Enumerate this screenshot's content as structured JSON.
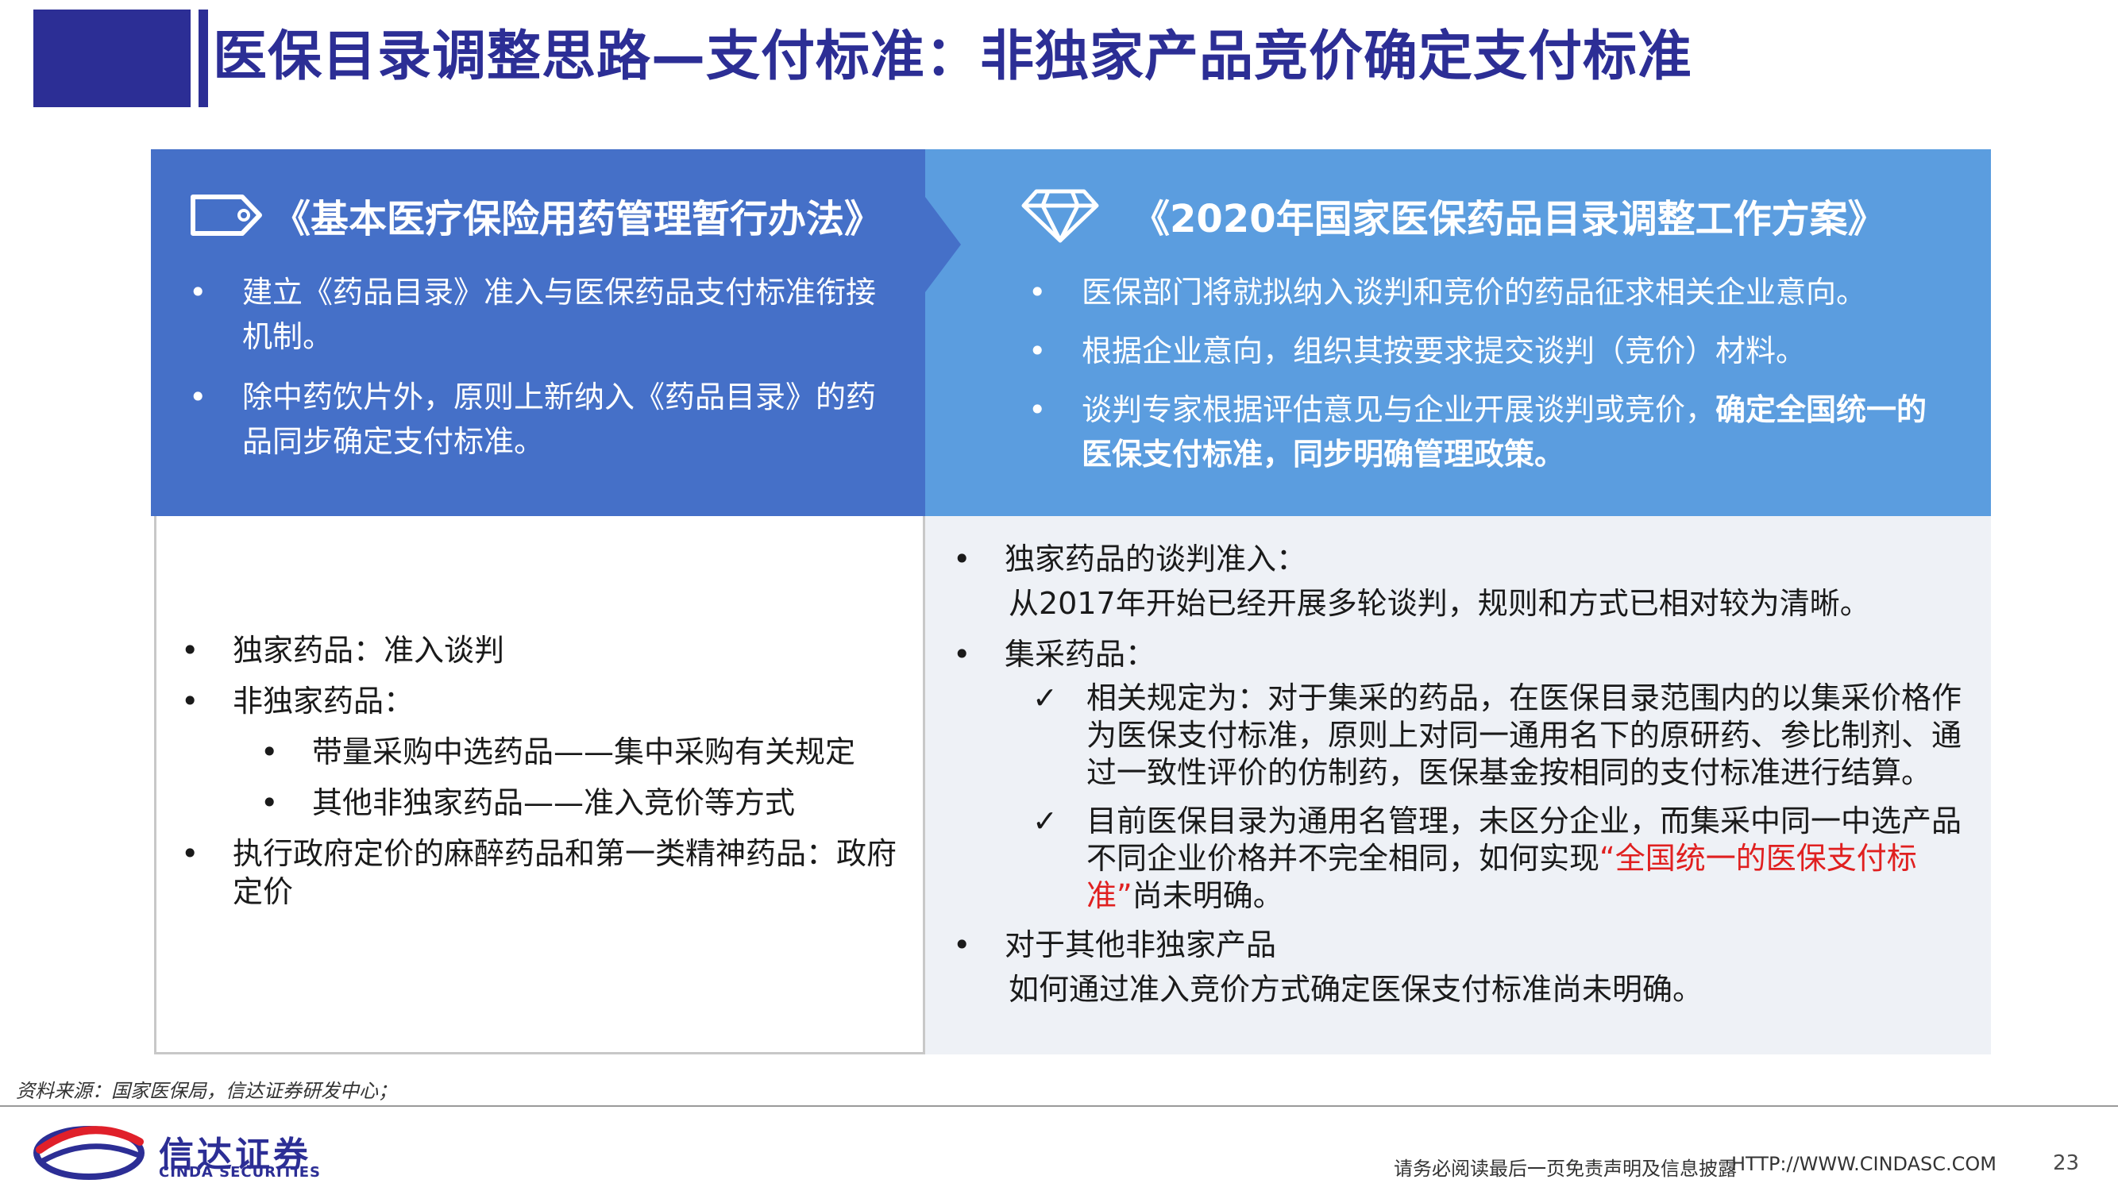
{
  "header": {
    "title": "医保目录调整思路—支付标准：非独家产品竞价确定支付标准"
  },
  "left_panel": {
    "heading": "《基本医疗保险用药管理暂行办法》",
    "icon": "tag-icon",
    "items": [
      "建立《药品目录》准入与医保药品支付标准衔接机制。",
      "除中药饮片外，原则上新纳入《药品目录》的药品同步确定支付标准。"
    ]
  },
  "right_panel": {
    "heading": "《2020年国家医保药品目录调整工作方案》",
    "icon": "diamond-icon",
    "items": [
      {
        "text": "医保部门将就拟纳入谈判和竞价的药品征求相关企业意向。"
      },
      {
        "text": "根据企业意向，组织其按要求提交谈判（竞价）材料。"
      },
      {
        "text": "谈判专家根据评估意见与企业开展谈判或竞价，",
        "strong": "确定全国统一的医保支付标准，同步明确管理政策。"
      }
    ]
  },
  "bottom_left": {
    "items": [
      {
        "text": "独家药品：准入谈判"
      },
      {
        "text": "非独家药品：",
        "sub": [
          "带量采购中选药品——集中采购有关规定",
          "其他非独家药品——准入竞价等方式"
        ]
      },
      {
        "text": "执行政府定价的麻醉药品和第一类精神药品：政府定价"
      }
    ]
  },
  "bottom_right": {
    "items": [
      {
        "title": "独家药品的谈判准入：",
        "desc": "从2017年开始已经开展多轮谈判，规则和方式已相对较为清晰。"
      },
      {
        "title": "集采药品：",
        "checks": [
          {
            "text": "相关规定为：对于集采的药品，在医保目录范围内的以集采价格作为医保支付标准，原则上对同一通用名下的原研药、参比制剂、通过一致性评价的仿制药，医保基金按相同的支付标准进行结算。"
          },
          {
            "text": "目前医保目录为通用名管理，未区分企业，而集采中同一中选产品不同企业价格并不完全相同，如何实现",
            "red": "“全国统一的医保支付标准”",
            "tail": "尚未明确。"
          }
        ]
      },
      {
        "title": "对于其他非独家产品",
        "desc": "如何通过准入竞价方式确定医保支付标准尚未明确。"
      }
    ]
  },
  "footer": {
    "source": "资料来源：国家医保局，信达证券研发中心；",
    "logo_cn": "信达证券",
    "logo_en": "CINDA SECURITIES",
    "disclaimer": "请务必阅读最后一页免责声明及信息披露",
    "url": "HTTP://WWW.CINDASC.COM",
    "page": "23"
  },
  "colors": {
    "brand": "#2c2e95",
    "left_panel": "#4570c8",
    "right_panel": "#5b9ddf",
    "highlight": "#e02020"
  },
  "glyphs": {
    "bullet": "•",
    "check": "✓"
  }
}
